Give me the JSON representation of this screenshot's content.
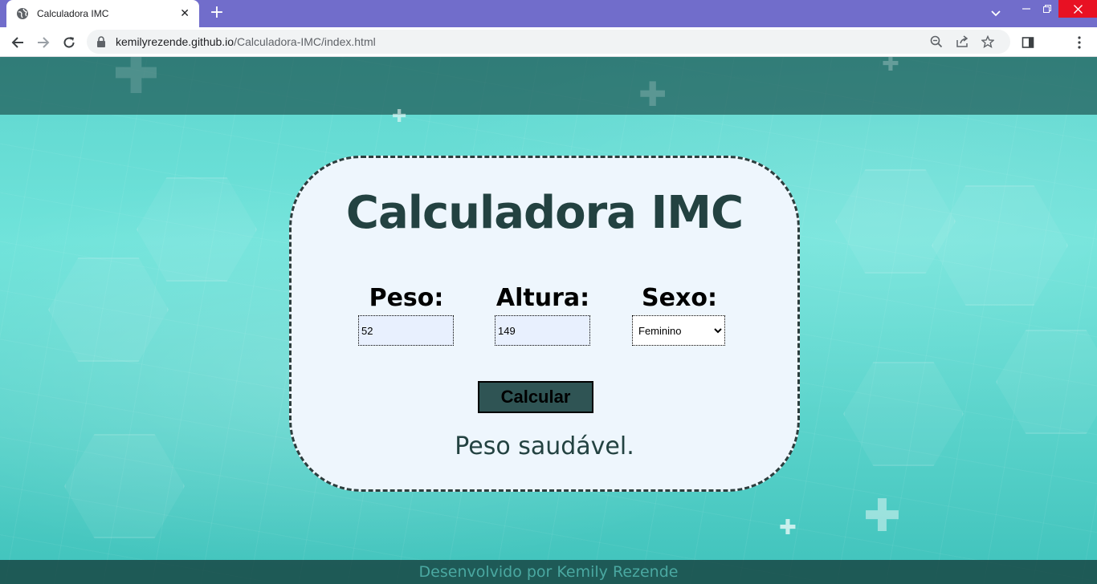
{
  "browser": {
    "tab_title": "Calculadora IMC",
    "tab_close": "✕",
    "new_tab": "+",
    "url_domain": "kemilyrezende.github.io",
    "url_path": "/Calculadora-IMC/index.html",
    "icons": [
      "globe-icon",
      "back-icon",
      "forward-icon",
      "reload-icon",
      "lock-icon",
      "zoom-icon",
      "share-icon",
      "star-icon",
      "side-panel-icon",
      "menu-icon"
    ]
  },
  "page": {
    "title": "Calculadora IMC",
    "peso": {
      "label": "Peso:",
      "value": "52"
    },
    "altura": {
      "label": "Altura:",
      "value": "149"
    },
    "sexo": {
      "label": "Sexo:",
      "selected": "Feminino"
    },
    "calculate_label": "Calcular",
    "result": "Peso saudável.",
    "footer": "Desenvolvido por Kemily Rezende"
  }
}
